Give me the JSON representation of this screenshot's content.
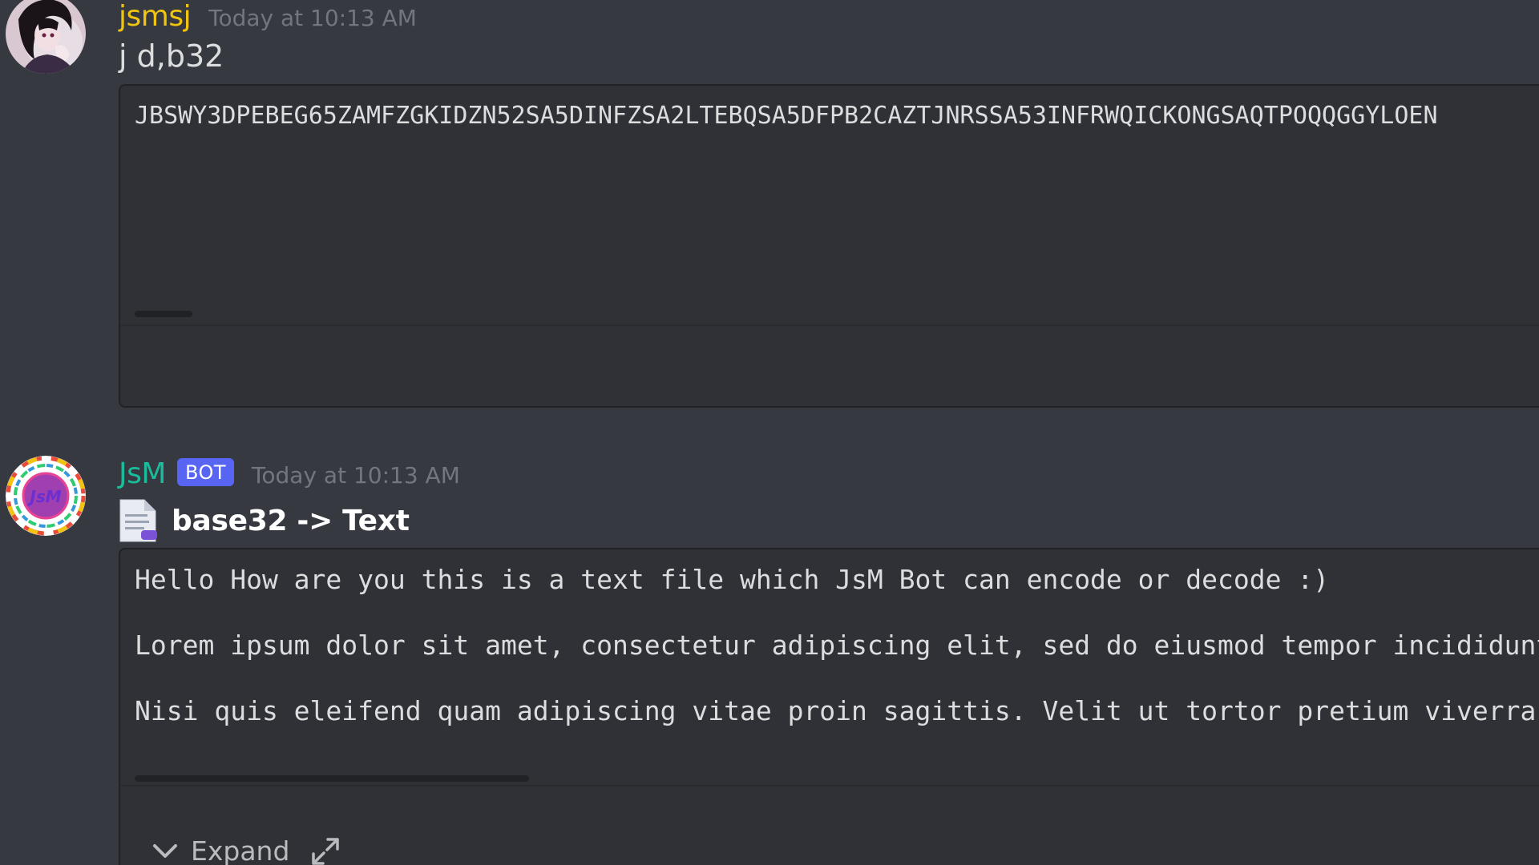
{
  "messages": [
    {
      "author": "jsmsj",
      "author_color": "#f1c40f",
      "timestamp": "Today at 10:13 AM",
      "content": "j d,b32",
      "attachment": {
        "lines": [
          "JBSWY3DPEBEG65ZAMFZGKIDZN52SA5DINFZSA2LTEBQSA5DFPB2CAZTJNRSSA53INFRWQICKONGSAQTPOQQGGYLOEN"
        ]
      }
    },
    {
      "author": "JsM",
      "author_color": "#1abc9c",
      "badge": "BOT",
      "timestamp": "Today at 10:13 AM",
      "embed_icon": "text-file-icon",
      "embed_title": "base32 -> Text",
      "attachment": {
        "lines": [
          "Hello How are you this is a text file which JsM Bot can encode or decode :)",
          "Lorem ipsum dolor sit amet, consectetur adipiscing elit, sed do eiusmod tempor incididunt ut",
          "Nisi quis eleifend quam adipiscing vitae proin sagittis. Velit ut tortor pretium viverra. S"
        ],
        "expand_label": "Expand",
        "expand_icon": "chevron-down-icon",
        "fullscreen_icon": "expand-arrows-icon"
      }
    }
  ],
  "colors": {
    "background": "#36393f",
    "code_background": "#2f3136",
    "bot_badge": "#5865f2",
    "muted": "#72767d"
  }
}
